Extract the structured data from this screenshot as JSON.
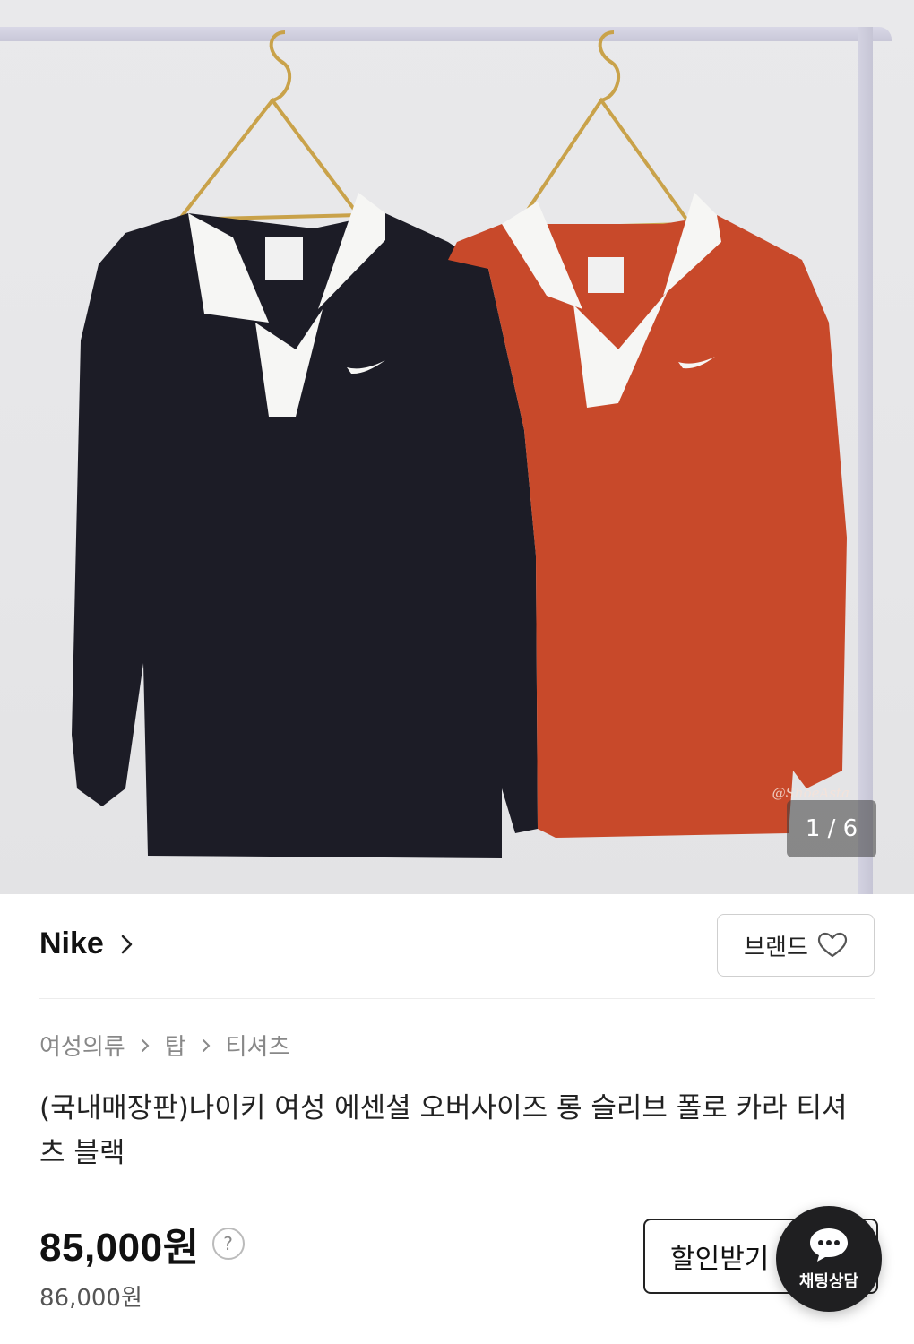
{
  "gallery": {
    "watermark": "@ShoeAsta",
    "counter": "1 / 6"
  },
  "brand": {
    "name": "Nike",
    "button_label": "브랜드"
  },
  "breadcrumb": {
    "items": [
      "여성의류",
      "탑",
      "티셔츠"
    ]
  },
  "product": {
    "title": "(국내매장판)나이키 여성 에센셜 오버사이즈 롱 슬리브 폴로 카라 티셔츠 블랙",
    "price": "85,000원",
    "original_price": "86,000원",
    "help_icon": "?"
  },
  "actions": {
    "discount_label": "할인받기",
    "chat_label": "채팅상담"
  },
  "colors": {
    "black_shirt": "#1c1c26",
    "orange_shirt": "#c8492a",
    "collar": "#f6f6f4",
    "chat_fab": "#1f1f21"
  }
}
